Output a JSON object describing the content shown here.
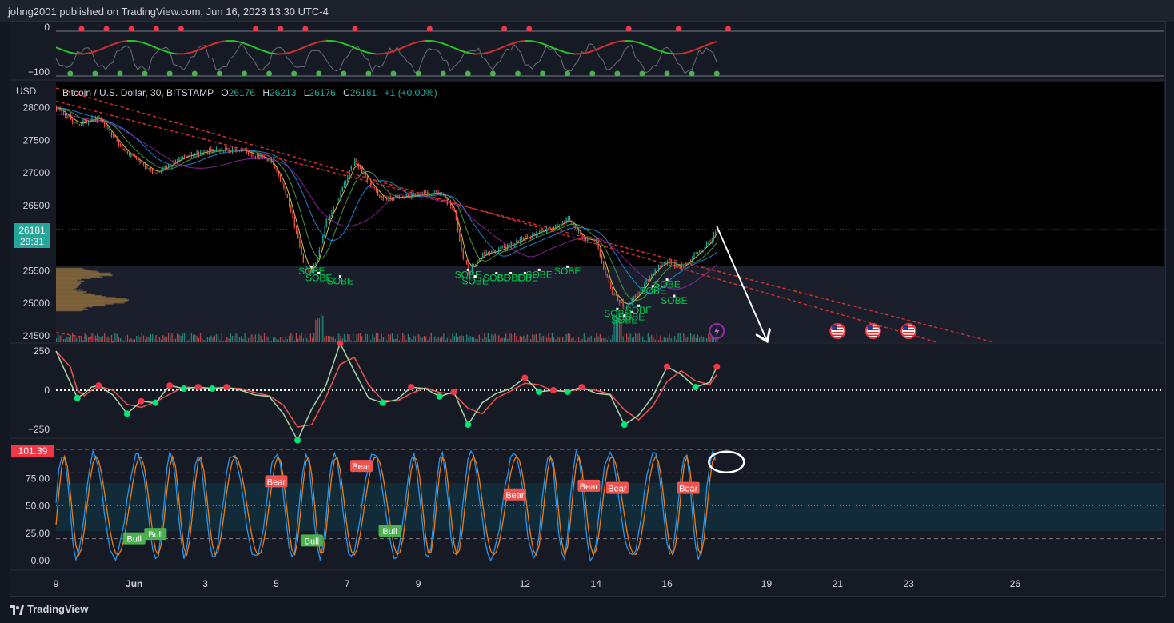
{
  "header": {
    "published": "johng2001 published on TradingView.com, Jun 16, 2023 13:30 UTC-4"
  },
  "footer": {
    "brand": "TradingView"
  },
  "colors": {
    "up": "#26a69a",
    "down": "#ef5350",
    "green_dot": "#4caf50",
    "red_dot": "#f23645",
    "stoch_k": "#2196f3",
    "stoch_d": "#f57c00"
  },
  "legend": {
    "symbol": "Bitcoin / U.S. Dollar, 30, BITSTAMP",
    "o_label": "O",
    "o": "26176",
    "h_label": "H",
    "h": "26213",
    "l_label": "L",
    "l": "26176",
    "c_label": "C",
    "c": "26181",
    "change": "+1 (+0.00%)"
  },
  "price_tag": {
    "value": "26181",
    "countdown": "29:31"
  },
  "stoch_tag": "101.39",
  "axis_unit": "USD",
  "chart_data": [
    {
      "type": "line",
      "panel": "top-oscillator",
      "y_ticks": [
        "0",
        "−100"
      ],
      "ylim": [
        -100,
        0
      ]
    },
    {
      "type": "candlestick",
      "panel": "price",
      "y_ticks": [
        "28000",
        "27500",
        "27000",
        "26500",
        "25500",
        "25000",
        "24500"
      ],
      "ylim": [
        24400,
        28400
      ],
      "x_ticks": [
        "9",
        "Jun",
        "3",
        "5",
        "7",
        "9",
        "12",
        "14",
        "16",
        "19",
        "21",
        "23",
        "26"
      ],
      "x_tick_pos": [
        0,
        5.5,
        10.5,
        15.5,
        20.5,
        25.5,
        33,
        38,
        43,
        50,
        55,
        60,
        67.5
      ],
      "x_range": [
        0,
        78
      ],
      "last_bar_x": 46.5,
      "close_path_x": [
        0,
        1.5,
        3,
        4,
        5,
        6,
        7,
        9,
        11,
        13,
        15,
        16,
        17,
        17.5,
        18,
        18.5,
        19,
        20,
        21,
        22,
        23,
        25,
        27,
        28,
        28.5,
        29,
        30,
        31,
        32,
        33,
        34,
        35,
        36,
        37,
        38,
        39,
        40,
        41,
        42,
        43,
        44,
        45,
        46,
        46.5
      ],
      "close_path_y": [
        28000,
        27750,
        27850,
        27550,
        27300,
        27150,
        27000,
        27250,
        27350,
        27350,
        27200,
        26800,
        26000,
        25550,
        25500,
        25800,
        26250,
        26700,
        27200,
        26850,
        26600,
        26650,
        26700,
        26400,
        25800,
        25500,
        25750,
        25800,
        25900,
        26000,
        26100,
        26150,
        26300,
        26000,
        25950,
        25200,
        24950,
        25150,
        25500,
        25650,
        25550,
        25750,
        25950,
        26181
      ],
      "volume_profile_range": [
        24900,
        25550
      ],
      "annotations": {
        "sobe_label": "SOBE",
        "sobe_points": [
          [
            18,
            25500
          ],
          [
            18.5,
            25400
          ],
          [
            20,
            25350
          ],
          [
            29,
            25450
          ],
          [
            29.5,
            25350
          ],
          [
            31,
            25400
          ],
          [
            32,
            25400
          ],
          [
            33,
            25400
          ],
          [
            34,
            25450
          ],
          [
            36,
            25500
          ],
          [
            39.5,
            24850
          ],
          [
            40,
            24750
          ],
          [
            40.5,
            24800
          ],
          [
            41,
            24900
          ],
          [
            42,
            25200
          ],
          [
            43,
            25300
          ],
          [
            43.5,
            25050
          ]
        ]
      },
      "trendlines": [
        {
          "from": [
            0,
            28100
          ],
          "to": [
            66,
            24400
          ]
        },
        {
          "from": [
            0,
            28300
          ],
          "to": [
            62,
            24400
          ]
        },
        {
          "from": [
            0,
            24550
          ],
          "to": [
            4,
            24400
          ]
        }
      ],
      "arrow": {
        "from": [
          46.5,
          26181
        ],
        "to": [
          50,
          24400
        ]
      },
      "event_icons_x": [
        46.5,
        55,
        57.5,
        60
      ]
    },
    {
      "type": "line",
      "panel": "middle-oscillator",
      "y_ticks": [
        "250",
        "0",
        "−250"
      ],
      "ylim": [
        -400,
        400
      ],
      "x": [
        0,
        1,
        1.5,
        2,
        2.5,
        3,
        4,
        5,
        6,
        7,
        8,
        9,
        10,
        11,
        12,
        13,
        14,
        15,
        16,
        17,
        18,
        19,
        20,
        21,
        22,
        23,
        24,
        25,
        26,
        27,
        28,
        29,
        30,
        31,
        32,
        33,
        34,
        35,
        36,
        37,
        38,
        39,
        40,
        41,
        42,
        43,
        44,
        45,
        46,
        46.5
      ],
      "values": [
        250,
        50,
        -50,
        -20,
        20,
        30,
        -30,
        -150,
        -70,
        -80,
        30,
        10,
        20,
        10,
        20,
        0,
        -30,
        -40,
        -150,
        -320,
        -120,
        30,
        300,
        120,
        -50,
        -80,
        -60,
        20,
        10,
        -40,
        -10,
        -220,
        -80,
        -20,
        10,
        80,
        -10,
        0,
        -10,
        20,
        -20,
        -30,
        -220,
        -160,
        -40,
        150,
        100,
        20,
        50,
        150
      ]
    },
    {
      "type": "line",
      "panel": "stochastic",
      "y_ticks": [
        "100.00",
        "75.00",
        "50.00",
        "25.00",
        "0.00"
      ],
      "ylim": [
        -5,
        105
      ],
      "bands": [
        20,
        80
      ],
      "labels": [
        {
          "text": "Bear",
          "x": 15.5,
          "y": 72
        },
        {
          "text": "Bear",
          "x": 21.5,
          "y": 86
        },
        {
          "text": "Bear",
          "x": 32.3,
          "y": 60
        },
        {
          "text": "Bear",
          "x": 37.5,
          "y": 68
        },
        {
          "text": "Bear",
          "x": 39.5,
          "y": 66
        },
        {
          "text": "Bear",
          "x": 44.5,
          "y": 66
        },
        {
          "text": "Bull",
          "x": 5.5,
          "y": 20
        },
        {
          "text": "Bull",
          "x": 7,
          "y": 24
        },
        {
          "text": "Bull",
          "x": 18,
          "y": 18
        },
        {
          "text": "Bull",
          "x": 23.5,
          "y": 27
        }
      ]
    }
  ]
}
